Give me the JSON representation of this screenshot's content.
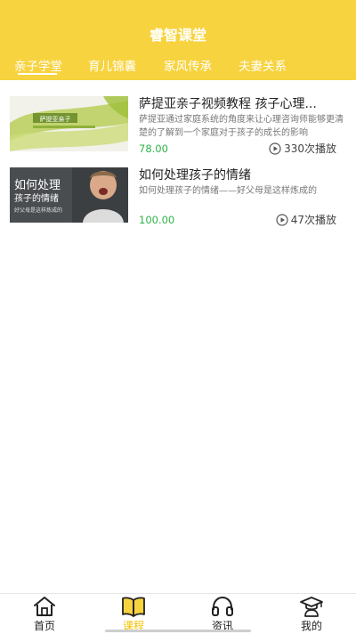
{
  "header": {
    "title": "睿智课堂",
    "background": "#f7d33f",
    "tabs": [
      {
        "label": "亲子学堂",
        "active": true
      },
      {
        "label": "育儿锦囊",
        "active": false
      },
      {
        "label": "家风传承",
        "active": false
      },
      {
        "label": "夫妻关系",
        "active": false
      }
    ]
  },
  "courses": [
    {
      "title": "萨提亚亲子视频教程 孩子心理...",
      "description": "萨提亚通过家庭系统的角度来让心理咨询师能够更清楚的了解到一个家庭对于孩子的成长的影响",
      "price": "78.00",
      "plays": "330次播放",
      "thumbnail_text": "萨提亚亲子"
    },
    {
      "title": "如何处理孩子的情绪",
      "description": "如何处理孩子的情绪——好父母是这样炼成的",
      "price": "100.00",
      "plays": "47次播放",
      "thumbnail_text_line1": "如何处理",
      "thumbnail_text_line2": "孩子的情绪",
      "thumbnail_text_line3": "好父母是这样炼成的"
    }
  ],
  "bottom_nav": [
    {
      "label": "首页",
      "icon": "home-icon",
      "active": false
    },
    {
      "label": "课程",
      "icon": "book-icon",
      "active": true
    },
    {
      "label": "资讯",
      "icon": "headphones-icon",
      "active": false
    },
    {
      "label": "我的",
      "icon": "graduate-icon",
      "active": false
    }
  ],
  "colors": {
    "accent": "#f7d33f",
    "active_nav": "#f2c200",
    "price": "#2fb24a"
  }
}
